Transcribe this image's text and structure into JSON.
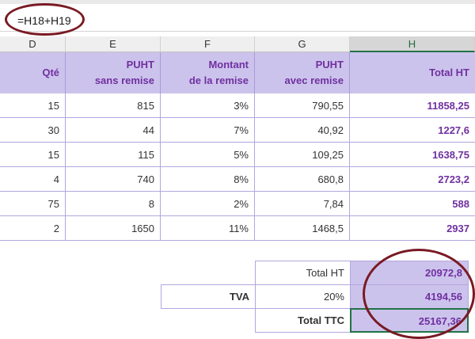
{
  "formula_bar": {
    "formula": "=H18+H19"
  },
  "columns": [
    "D",
    "E",
    "F",
    "G",
    "H"
  ],
  "table": {
    "headers": [
      "Qté",
      "PUHT\nsans remise",
      "Montant\nde la remise",
      "PUHT\navec remise",
      "Total HT"
    ],
    "rows": [
      [
        "15",
        "815",
        "3%",
        "790,55",
        "11858,25"
      ],
      [
        "30",
        "44",
        "7%",
        "40,92",
        "1227,6"
      ],
      [
        "15",
        "115",
        "5%",
        "109,25",
        "1638,75"
      ],
      [
        "4",
        "740",
        "8%",
        "680,8",
        "2723,2"
      ],
      [
        "75",
        "8",
        "2%",
        "7,84",
        "588"
      ],
      [
        "2",
        "1650",
        "11%",
        "1468,5",
        "2937"
      ]
    ]
  },
  "summary": {
    "total_ht_label": "Total HT",
    "total_ht_value": "20972,8",
    "tva_label": "TVA",
    "tva_rate": "20%",
    "tva_value": "4194,56",
    "total_ttc_label": "Total TTC",
    "total_ttc_value": "25167,36"
  },
  "colors": {
    "header_bg": "#ccc3ec",
    "accent_purple": "#7030a0",
    "annotation": "#7a1a24",
    "selection": "#217346"
  }
}
